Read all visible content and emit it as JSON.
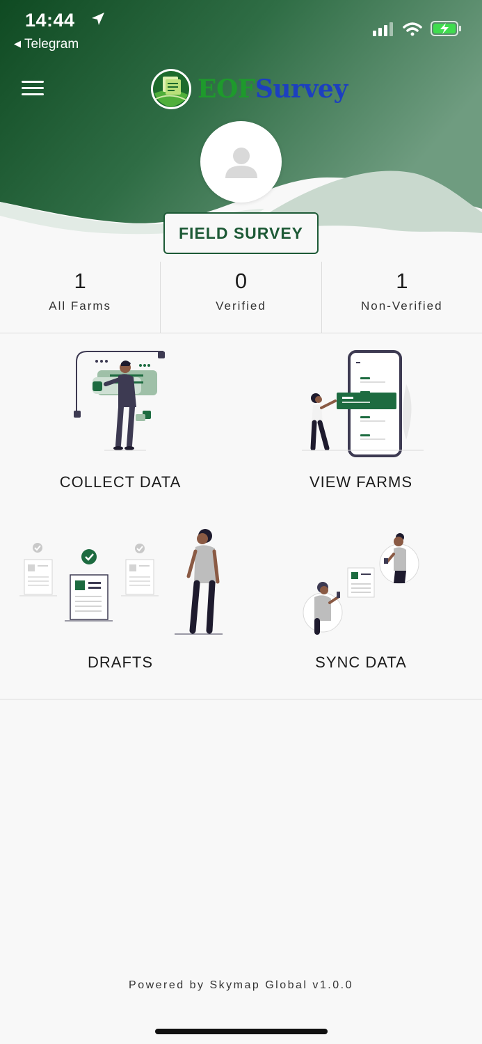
{
  "status_bar": {
    "time": "14:44",
    "back_app": "Telegram",
    "icons": [
      "location-arrow-icon",
      "cellular-signal-icon",
      "wifi-icon",
      "battery-charging-icon"
    ]
  },
  "header": {
    "menu_icon": "hamburger-menu-icon",
    "logo": {
      "part1": "EOF",
      "part2": "Survey"
    },
    "avatar_icon": "user-avatar-icon"
  },
  "colors": {
    "brand_green": "#1d5a36",
    "logo_green": "#1e9a2c",
    "logo_blue": "#1c3fc0"
  },
  "field_survey_button": "FIELD SURVEY",
  "stats": [
    {
      "value": "1",
      "label": "All Farms"
    },
    {
      "value": "0",
      "label": "Verified"
    },
    {
      "value": "1",
      "label": "Non-Verified"
    }
  ],
  "tiles": [
    {
      "label": "COLLECT DATA",
      "illustration": "collect-data-illustration"
    },
    {
      "label": "VIEW FARMS",
      "illustration": "view-farms-illustration"
    },
    {
      "label": "DRAFTS",
      "illustration": "drafts-illustration"
    },
    {
      "label": "SYNC DATA",
      "illustration": "sync-data-illustration"
    }
  ],
  "footer": "Powered by Skymap Global v1.0.0"
}
